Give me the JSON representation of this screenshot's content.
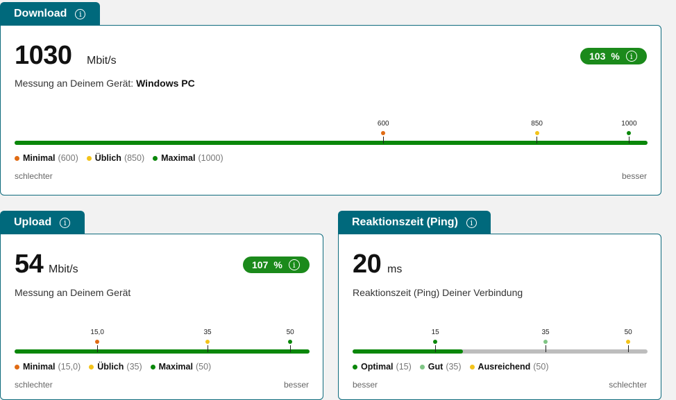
{
  "colors": {
    "tab": "#00697c",
    "good": "#0a870a",
    "track": "#bdbdbd",
    "orange": "#e06b14",
    "yellow": "#f3c31a",
    "light_green": "#7fc584",
    "dark_green": "#0a870a"
  },
  "icons": {
    "info": "info-icon"
  },
  "download": {
    "tab": "Download",
    "value": "1030",
    "unit": "Mbit/s",
    "desc": "Messung an Deinem Gerät:",
    "device": "Windows PC",
    "badge_value": "103",
    "badge_sign": "%",
    "bar_max": 1030,
    "bar_fill_value": 1030,
    "markers": [
      {
        "label": "600",
        "value": 600,
        "color": "#e06b14"
      },
      {
        "label": "850",
        "value": 850,
        "color": "#f3c31a"
      },
      {
        "label": "1000",
        "value": 1000,
        "color": "#0a870a"
      }
    ],
    "legend": [
      {
        "name": "Minimal",
        "val": "(600)",
        "color": "#e06b14"
      },
      {
        "name": "Üblich",
        "val": "(850)",
        "color": "#f3c31a"
      },
      {
        "name": "Maximal",
        "val": "(1000)",
        "color": "#0a870a"
      }
    ],
    "left_label": "schlechter",
    "right_label": "besser"
  },
  "upload": {
    "tab": "Upload",
    "value": "54",
    "unit": "Mbit/s",
    "desc": "Messung an Deinem Gerät",
    "badge_value": "107",
    "badge_sign": "%",
    "bar_max": 53.5,
    "bar_fill_value": 53.5,
    "markers": [
      {
        "label": "15,0",
        "value": 15,
        "color": "#e06b14"
      },
      {
        "label": "35",
        "value": 35,
        "color": "#f3c31a"
      },
      {
        "label": "50",
        "value": 50,
        "color": "#0a870a"
      }
    ],
    "legend": [
      {
        "name": "Minimal",
        "val": "(15,0)",
        "color": "#e06b14"
      },
      {
        "name": "Üblich",
        "val": "(35)",
        "color": "#f3c31a"
      },
      {
        "name": "Maximal",
        "val": "(50)",
        "color": "#0a870a"
      }
    ],
    "left_label": "schlechter",
    "right_label": "besser"
  },
  "ping": {
    "tab": "Reaktionszeit (Ping)",
    "value": "20",
    "unit": "ms",
    "desc": "Reaktionszeit (Ping) Deiner Verbindung",
    "bar_max": 53.5,
    "bar_fill_value": 20,
    "markers": [
      {
        "label": "15",
        "value": 15,
        "color": "#0a870a"
      },
      {
        "label": "35",
        "value": 35,
        "color": "#7fc584"
      },
      {
        "label": "50",
        "value": 50,
        "color": "#f3c31a"
      }
    ],
    "legend": [
      {
        "name": "Optimal",
        "val": "(15)",
        "color": "#0a870a"
      },
      {
        "name": "Gut",
        "val": "(35)",
        "color": "#7fc584"
      },
      {
        "name": "Ausreichend",
        "val": "(50)",
        "color": "#f3c31a"
      }
    ],
    "left_label": "besser",
    "right_label": "schlechter"
  }
}
